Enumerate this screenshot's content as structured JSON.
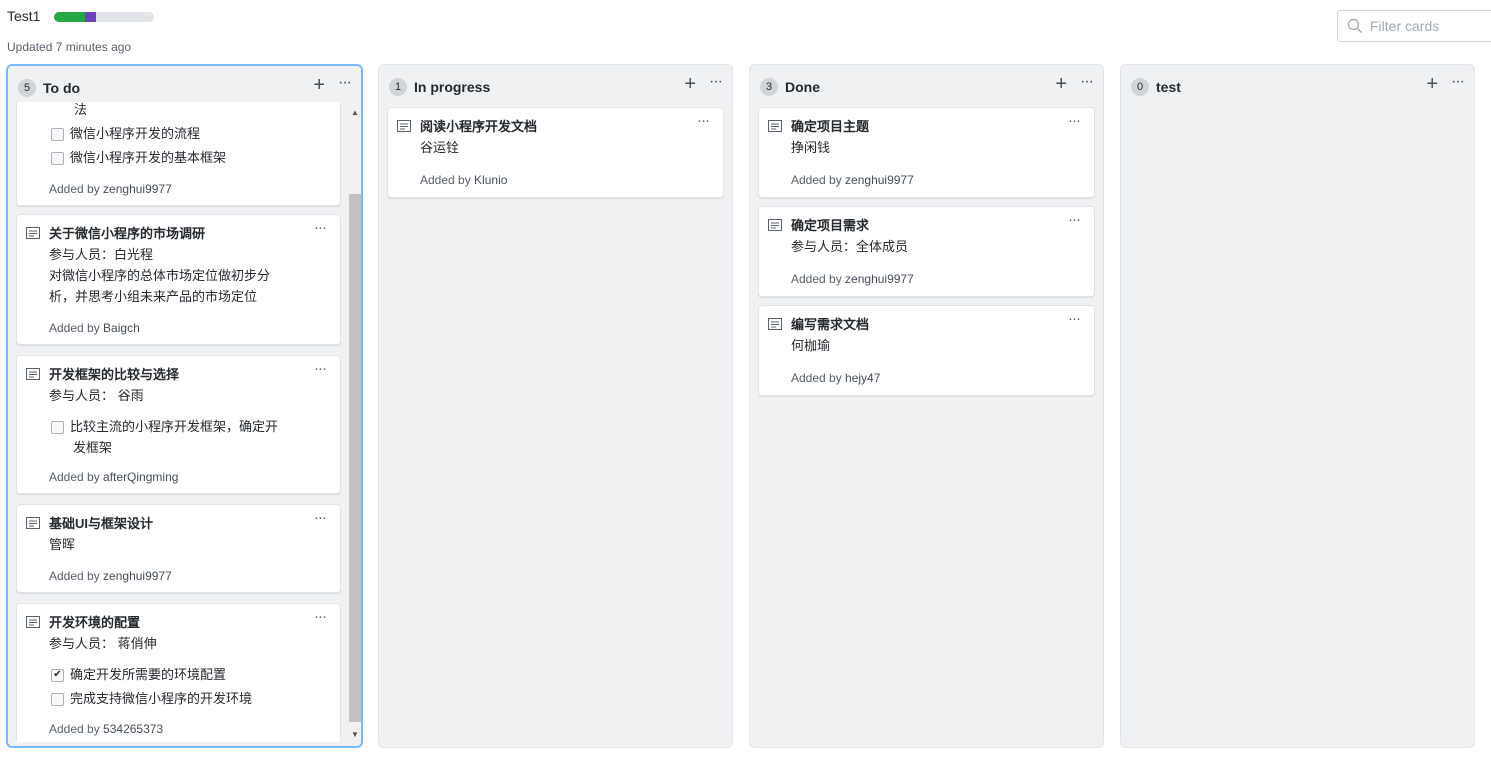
{
  "project": {
    "title": "Test1",
    "updated": "Updated 7 minutes ago",
    "progress": {
      "done_fraction": 0.31,
      "in_progress_fraction": 0.11,
      "done_color": "#28a745",
      "in_progress_color": "#6f42c1"
    }
  },
  "filter": {
    "placeholder": "Filter cards",
    "icon": "search-icon"
  },
  "columns": [
    {
      "count": "5",
      "name": "To do",
      "cards": [
        {
          "partial_text": "法",
          "checks": [
            {
              "label": "微信小程序开发的流程",
              "checked": false
            },
            {
              "label": "微信小程序开发的基本框架",
              "checked": false
            }
          ],
          "added_prefix": "Added by ",
          "user": "zenghui9977"
        },
        {
          "title": "关于微信小程序的市场调研",
          "lines": [
            "参与人员：白光程",
            "对微信小程序的总体市场定位做初步分",
            "析，并思考小组未来产品的市场定位"
          ],
          "added_prefix": "Added by ",
          "user": "Baigch"
        },
        {
          "title": "开发框架的比较与选择",
          "lines": [
            "参与人员：  谷雨"
          ],
          "checks": [
            {
              "label": "比较主流的小程序开发框架，确定开",
              "label2": "发框架",
              "checked": false
            }
          ],
          "added_prefix": "Added by ",
          "user": "afterQingming"
        },
        {
          "title": "基础UI与框架设计",
          "lines": [
            "管晖"
          ],
          "added_prefix": "Added by ",
          "user": "zenghui9977"
        },
        {
          "title": "开发环境的配置",
          "lines": [
            "参与人员：  蒋俏伸"
          ],
          "checks": [
            {
              "label": "确定开发所需要的环境配置",
              "checked": true
            },
            {
              "label": "完成支持微信小程序的开发环境",
              "checked": false
            }
          ],
          "added_prefix": "Added by ",
          "user": "534265373"
        }
      ]
    },
    {
      "count": "1",
      "name": "In progress",
      "cards": [
        {
          "title": "阅读小程序开发文档",
          "lines": [
            "谷运铨"
          ],
          "added_prefix": "Added by ",
          "user": "Klunio"
        }
      ]
    },
    {
      "count": "3",
      "name": "Done",
      "cards": [
        {
          "title": "确定项目主题",
          "lines": [
            "挣闲钱"
          ],
          "added_prefix": "Added by ",
          "user": "zenghui9977"
        },
        {
          "title": "确定项目需求",
          "lines": [
            "参与人员：全体成员"
          ],
          "added_prefix": "Added by ",
          "user": "zenghui9977"
        },
        {
          "title": "编写需求文档",
          "lines": [
            "何枷瑜"
          ],
          "added_prefix": "Added by ",
          "user": "hejy47"
        }
      ]
    },
    {
      "count": "0",
      "name": "test",
      "cards": []
    }
  ],
  "icons": {
    "add": "plus-icon",
    "more": "kebab-horizontal-icon",
    "note": "note-icon"
  },
  "glyphs": {
    "plus": "+",
    "more": "···",
    "check": "✔",
    "up": "▲",
    "down": "▼"
  }
}
